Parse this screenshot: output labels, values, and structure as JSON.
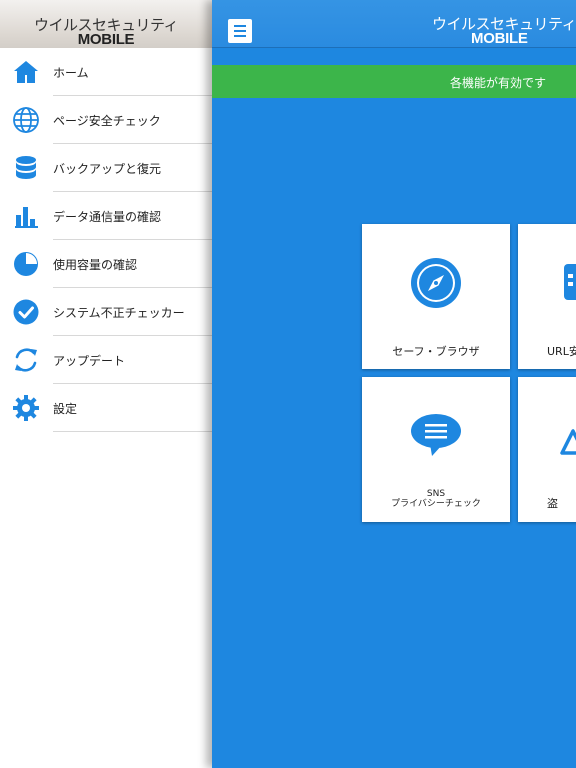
{
  "drawer": {
    "logo_line1": "ウイルスセキュリティ",
    "logo_line2": "MOBILE",
    "items": [
      {
        "label": "ホーム",
        "icon": "home-icon"
      },
      {
        "label": "ページ安全チェック",
        "icon": "globe-icon"
      },
      {
        "label": "バックアップと復元",
        "icon": "database-icon"
      },
      {
        "label": "データ通信量の確認",
        "icon": "bar-chart-icon"
      },
      {
        "label": "使用容量の確認",
        "icon": "pie-chart-icon"
      },
      {
        "label": "システム不正チェッカー",
        "icon": "check-circle-icon"
      },
      {
        "label": "アップデート",
        "icon": "refresh-icon"
      },
      {
        "label": "設定",
        "icon": "gear-icon"
      }
    ]
  },
  "header": {
    "app_line1": "ウイルスセキュリティ",
    "app_line2": "MOBILE"
  },
  "status": {
    "text": "各機能が有効です"
  },
  "tiles": [
    {
      "label": "セーフ・ブラウザ",
      "icon": "compass-icon"
    },
    {
      "label": "URL安",
      "icon": "calendar-icon"
    },
    {
      "label_line1": "SNS",
      "label_line2": "プライバシーチェック",
      "icon": "chat-bubble-icon"
    },
    {
      "label": "盗",
      "icon": "warning-icon"
    }
  ],
  "colors": {
    "accent": "#1e87e0",
    "status_green": "#3cb54a",
    "icon_blue": "#1e87e0"
  }
}
